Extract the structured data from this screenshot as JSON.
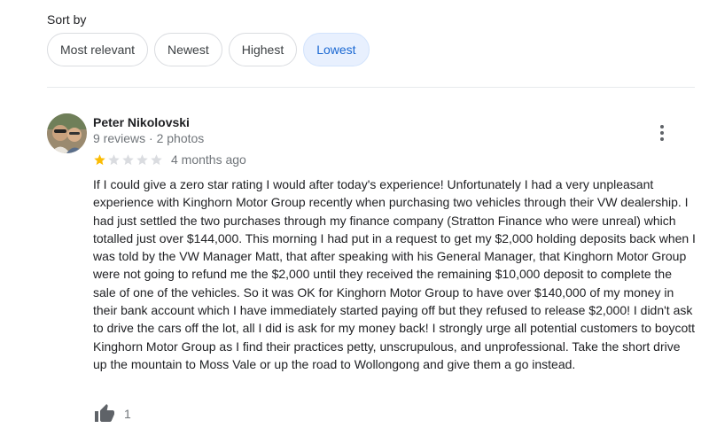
{
  "sort": {
    "label": "Sort by",
    "options": [
      "Most relevant",
      "Newest",
      "Highest",
      "Lowest"
    ],
    "selected": "Lowest"
  },
  "review": {
    "author": "Peter Nikolovski",
    "meta": "9 reviews · 2 photos",
    "rating": 1,
    "max_rating": 5,
    "time": "4 months ago",
    "text": "If I could give a zero star rating I would after today's experience! Unfortunately I had a very unpleasant experience with Kinghorn Motor Group recently when purchasing two vehicles through their VW dealership. I had just settled the two purchases through my finance company (Stratton Finance who were unreal) which totalled just over $144,000. This morning I had put in a request to get my $2,000 holding deposits back when I was told by the VW Manager Matt, that after speaking with his General Manager, that Kinghorn Motor Group were not going to refund me the $2,000 until they received the remaining $10,000 deposit to complete the sale of one of the vehicles. So it was OK for Kinghorn Motor Group to have over $140,000 of my money in their bank account which I have immediately started paying off but they refused to release $2,000! I didn't ask to drive the cars off the lot, all I did is ask for my money back! I strongly urge all potential customers to boycott Kinghorn Motor Group as I find their practices petty, unscrupulous, and unprofessional. Take the short drive up the mountain to Moss Vale or up the road to Wollongong and give them a go instead.",
    "likes": "1"
  },
  "colors": {
    "star_filled": "#fbbc04",
    "star_empty": "#dadce0",
    "selected_chip_bg": "#e8f0fe",
    "selected_chip_text": "#1967d2"
  },
  "icons": {
    "avatar": "profile-photo",
    "more": "more-vertical-icon",
    "like": "thumbs-up-icon"
  }
}
